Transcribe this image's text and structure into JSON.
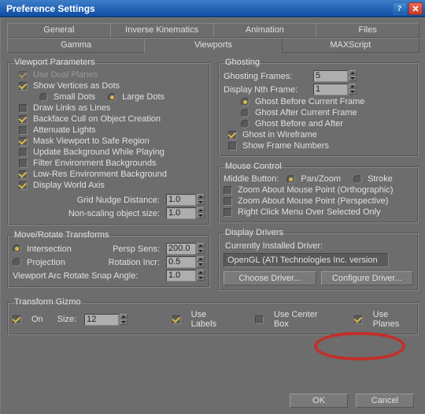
{
  "window": {
    "title": "Preference Settings"
  },
  "tabs_row1": [
    "General",
    "Inverse Kinematics",
    "Animation",
    "Files"
  ],
  "tabs_row2": [
    "Gamma",
    "Viewports",
    "MAXScript"
  ],
  "active_tab": "Viewports",
  "viewport_params": {
    "legend": "Viewport Parameters",
    "use_dual_planes": "Use Dual Planes",
    "show_vertices": "Show Vertices as Dots",
    "small_dots": "Small Dots",
    "large_dots": "Large Dots",
    "draw_links": "Draw Links as Lines",
    "backface_cull": "Backface Cull on Object Creation",
    "attenuate_lights": "Attenuate Lights",
    "mask_viewport": "Mask Viewport to Safe Region",
    "update_bg": "Update Background While Playing",
    "filter_env": "Filter Environment Backgrounds",
    "lowres_env": "Low-Res Environment Background",
    "display_axis": "Display World Axis",
    "grid_nudge_label": "Grid Nudge Distance:",
    "grid_nudge_val": "1.0",
    "nonscale_label": "Non-scaling object size:",
    "nonscale_val": "1.0"
  },
  "move_rotate": {
    "legend": "Move/Rotate Transforms",
    "intersection": "Intersection",
    "projection": "Projection",
    "persp_label": "Persp Sens:",
    "persp_val": "200.0",
    "rot_label": "Rotation Incr:",
    "rot_val": "0.5",
    "arc_label": "Viewport Arc Rotate Snap Angle:",
    "arc_val": "1.0"
  },
  "gizmo": {
    "legend": "Transform Gizmo",
    "on": "On",
    "size_label": "Size:",
    "size_val": "12",
    "use_labels": "Use Labels",
    "use_center": "Use Center Box",
    "use_planes": "Use Planes"
  },
  "ghosting": {
    "legend": "Ghosting",
    "frames_label": "Ghosting Frames:",
    "frames_val": "5",
    "nth_label": "Display Nth Frame:",
    "nth_val": "1",
    "before": "Ghost Before Current Frame",
    "after": "Ghost After Current Frame",
    "both": "Ghost Before and After",
    "wire": "Ghost in Wireframe",
    "showfn": "Show Frame Numbers"
  },
  "mouse": {
    "legend": "Mouse Control",
    "middle_label": "Middle Button:",
    "pan": "Pan/Zoom",
    "stroke": "Stroke",
    "zoom_ortho": "Zoom About Mouse Point (Orthographic)",
    "zoom_persp": "Zoom About Mouse Point (Perspective)",
    "rclick": "Right Click Menu Over Selected Only"
  },
  "drivers": {
    "legend": "Display Drivers",
    "installed_label": "Currently Installed Driver:",
    "installed_val": "OpenGL (ATI Technologies Inc. version",
    "choose": "Choose Driver...",
    "configure": "Configure Driver..."
  },
  "buttons": {
    "ok": "OK",
    "cancel": "Cancel"
  }
}
